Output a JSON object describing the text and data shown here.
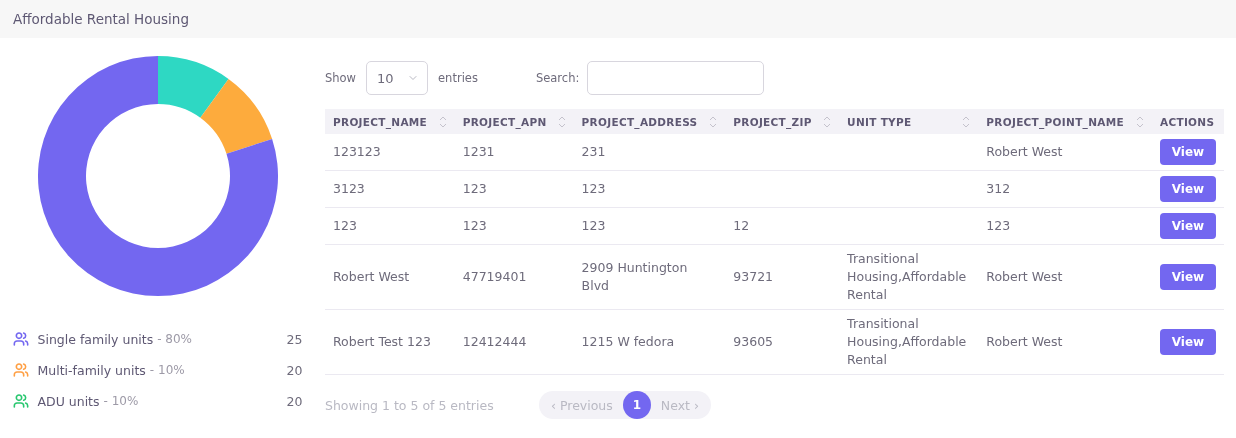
{
  "header": {
    "title": "Affordable Rental Housing"
  },
  "chart": {
    "chart_data": {
      "type": "donut",
      "colors": [
        "#2ed8c3",
        "#fdab3d",
        "#7367f0"
      ],
      "values": [
        10,
        10,
        80
      ]
    }
  },
  "legend": [
    {
      "label": "Single family units",
      "percent": "- 80%",
      "count": "25",
      "color": "#7367f0"
    },
    {
      "label": "Multi-family units",
      "percent": "- 10%",
      "count": "20",
      "color": "#ff9f43"
    },
    {
      "label": "ADU units",
      "percent": "- 10%",
      "count": "20",
      "color": "#28c76f"
    }
  ],
  "controls": {
    "show_label": "Show",
    "page_size": "10",
    "entries_label": "entries",
    "search_label": "Search:"
  },
  "table": {
    "columns": [
      {
        "label": "PROJECT_NAME",
        "sortable": true
      },
      {
        "label": "PROJECT_APN",
        "sortable": true
      },
      {
        "label": "PROJECT_ADDRESS",
        "sortable": true
      },
      {
        "label": "PROJECT_ZIP",
        "sortable": true
      },
      {
        "label": "UNIT TYPE",
        "sortable": true
      },
      {
        "label": "PROJECT_POINT_NAME",
        "sortable": true
      },
      {
        "label": "ACTIONS",
        "sortable": false
      }
    ],
    "rows": [
      {
        "cells": [
          "123123",
          "1231",
          "231",
          "",
          "",
          "Robert West"
        ],
        "action": "View"
      },
      {
        "cells": [
          "3123",
          "123",
          "123",
          "",
          "",
          "312"
        ],
        "action": "View"
      },
      {
        "cells": [
          "123",
          "123",
          "123",
          "12",
          "",
          "123"
        ],
        "action": "View"
      },
      {
        "cells": [
          "Robert West",
          "47719401",
          "2909 Huntington Blvd",
          "93721",
          "Transitional Housing,Affordable Rental",
          "Robert West"
        ],
        "action": "View"
      },
      {
        "cells": [
          "Robert Test 123",
          "12412444",
          "1215 W fedora",
          "93605",
          "Transitional Housing,Affordable Rental",
          "Robert West"
        ],
        "action": "View"
      }
    ]
  },
  "footer": {
    "info": "Showing 1 to 5 of 5 entries",
    "previous": "‹ Previous",
    "next": "Next ›",
    "pages": [
      {
        "label": "1",
        "selected": true
      }
    ]
  }
}
